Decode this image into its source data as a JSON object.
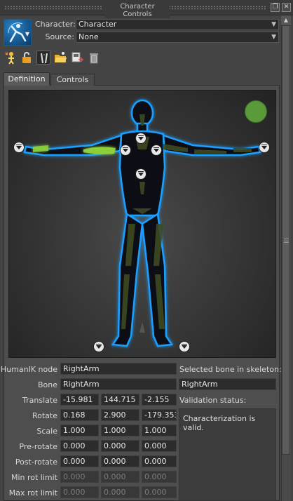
{
  "window": {
    "title": "Character Controls"
  },
  "header": {
    "character_label": "Character:",
    "character_value": "Character",
    "source_label": "Source:",
    "source_value": "None"
  },
  "toolbar": {
    "icons": [
      "create-character-icon",
      "lock-icon",
      "skeleton-icon",
      "folder-icon",
      "export-icon",
      "delete-icon"
    ]
  },
  "tabs": [
    {
      "label": "Definition",
      "active": true
    },
    {
      "label": "Controls",
      "active": false
    }
  ],
  "viewer": {
    "status_color": "#5a9a3a",
    "accent_color": "#1ea0ff",
    "selected_color": "#8ccf3a"
  },
  "properties": {
    "humanik_node_label": "HumanIK node",
    "humanik_node_value": "RightArm",
    "bone_label": "Bone",
    "bone_value": "RightArm",
    "selected_bone_label": "Selected bone in skeleton:",
    "selected_bone_value": "RightArm",
    "validation_label": "Validation status:",
    "validation_message": "Characterization is valid.",
    "rows": [
      {
        "label": "Translate",
        "values": [
          "-15.981",
          "144.715",
          "-2.155"
        ],
        "dim": false
      },
      {
        "label": "Rotate",
        "values": [
          "0.168",
          "2.900",
          "-179.353"
        ],
        "dim": false
      },
      {
        "label": "Scale",
        "values": [
          "1.000",
          "1.000",
          "1.000"
        ],
        "dim": false
      },
      {
        "label": "Pre-rotate",
        "values": [
          "0.000",
          "0.000",
          "0.000"
        ],
        "dim": false
      },
      {
        "label": "Post-rotate",
        "values": [
          "0.000",
          "0.000",
          "0.000"
        ],
        "dim": false
      },
      {
        "label": "Min rot limit",
        "values": [
          "0.000",
          "0.000",
          "0.000"
        ],
        "dim": true
      },
      {
        "label": "Max rot limit",
        "values": [
          "0.000",
          "0.000",
          "0.000"
        ],
        "dim": true
      }
    ]
  }
}
